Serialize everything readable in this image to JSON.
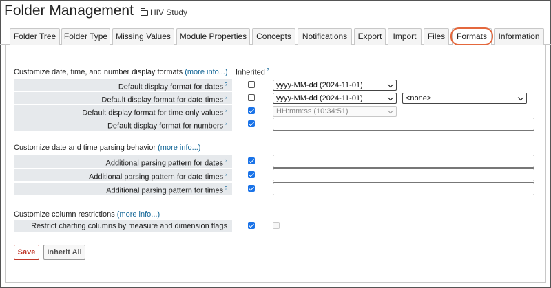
{
  "header": {
    "title": "Folder Management",
    "folder_name": "HIV Study"
  },
  "tabs": [
    {
      "label": "Folder Tree"
    },
    {
      "label": "Folder Type"
    },
    {
      "label": "Missing Values"
    },
    {
      "label": "Module Properties"
    },
    {
      "label": "Concepts"
    },
    {
      "label": "Notifications"
    },
    {
      "label": "Export"
    },
    {
      "label": "Import"
    },
    {
      "label": "Files"
    },
    {
      "label": "Formats",
      "active": true
    },
    {
      "label": "Information"
    }
  ],
  "formats": {
    "heading": "Customize date, time, and number display formats",
    "more_info": "(more info...)",
    "inherited_label": "Inherited",
    "help_mark": "?",
    "rows": [
      {
        "label": "Default display format for dates",
        "inherited": false,
        "value": "yyyy-MM-dd (2024-11-01)"
      },
      {
        "label": "Default display format for date-times",
        "inherited": false,
        "value": "yyyy-MM-dd (2024-11-01)",
        "time_value": "<none>"
      },
      {
        "label": "Default display format for time-only values",
        "inherited": true,
        "value": "HH:mm:ss (10:34:51)"
      },
      {
        "label": "Default display format for numbers",
        "inherited": true,
        "value": ""
      }
    ]
  },
  "parsing": {
    "heading": "Customize date and time parsing behavior",
    "more_info": "(more info...)",
    "rows": [
      {
        "label": "Additional parsing pattern for dates",
        "inherited": true,
        "value": ""
      },
      {
        "label": "Additional parsing pattern for date-times",
        "inherited": true,
        "value": ""
      },
      {
        "label": "Additional parsing pattern for times",
        "inherited": true,
        "value": ""
      }
    ]
  },
  "restrictions": {
    "heading": "Customize column restrictions",
    "more_info": "(more info...)",
    "rows": [
      {
        "label": "Restrict charting columns by measure and dimension flags",
        "inherited": true,
        "value": false
      }
    ]
  },
  "buttons": {
    "save": "Save",
    "inherit_all": "Inherit All"
  },
  "colors": {
    "link": "#116596",
    "highlight": "#e4683d",
    "checkbox_checked": "#1a73e8",
    "save_button": "#c0392b",
    "label_bg": "#e6e9ec"
  }
}
